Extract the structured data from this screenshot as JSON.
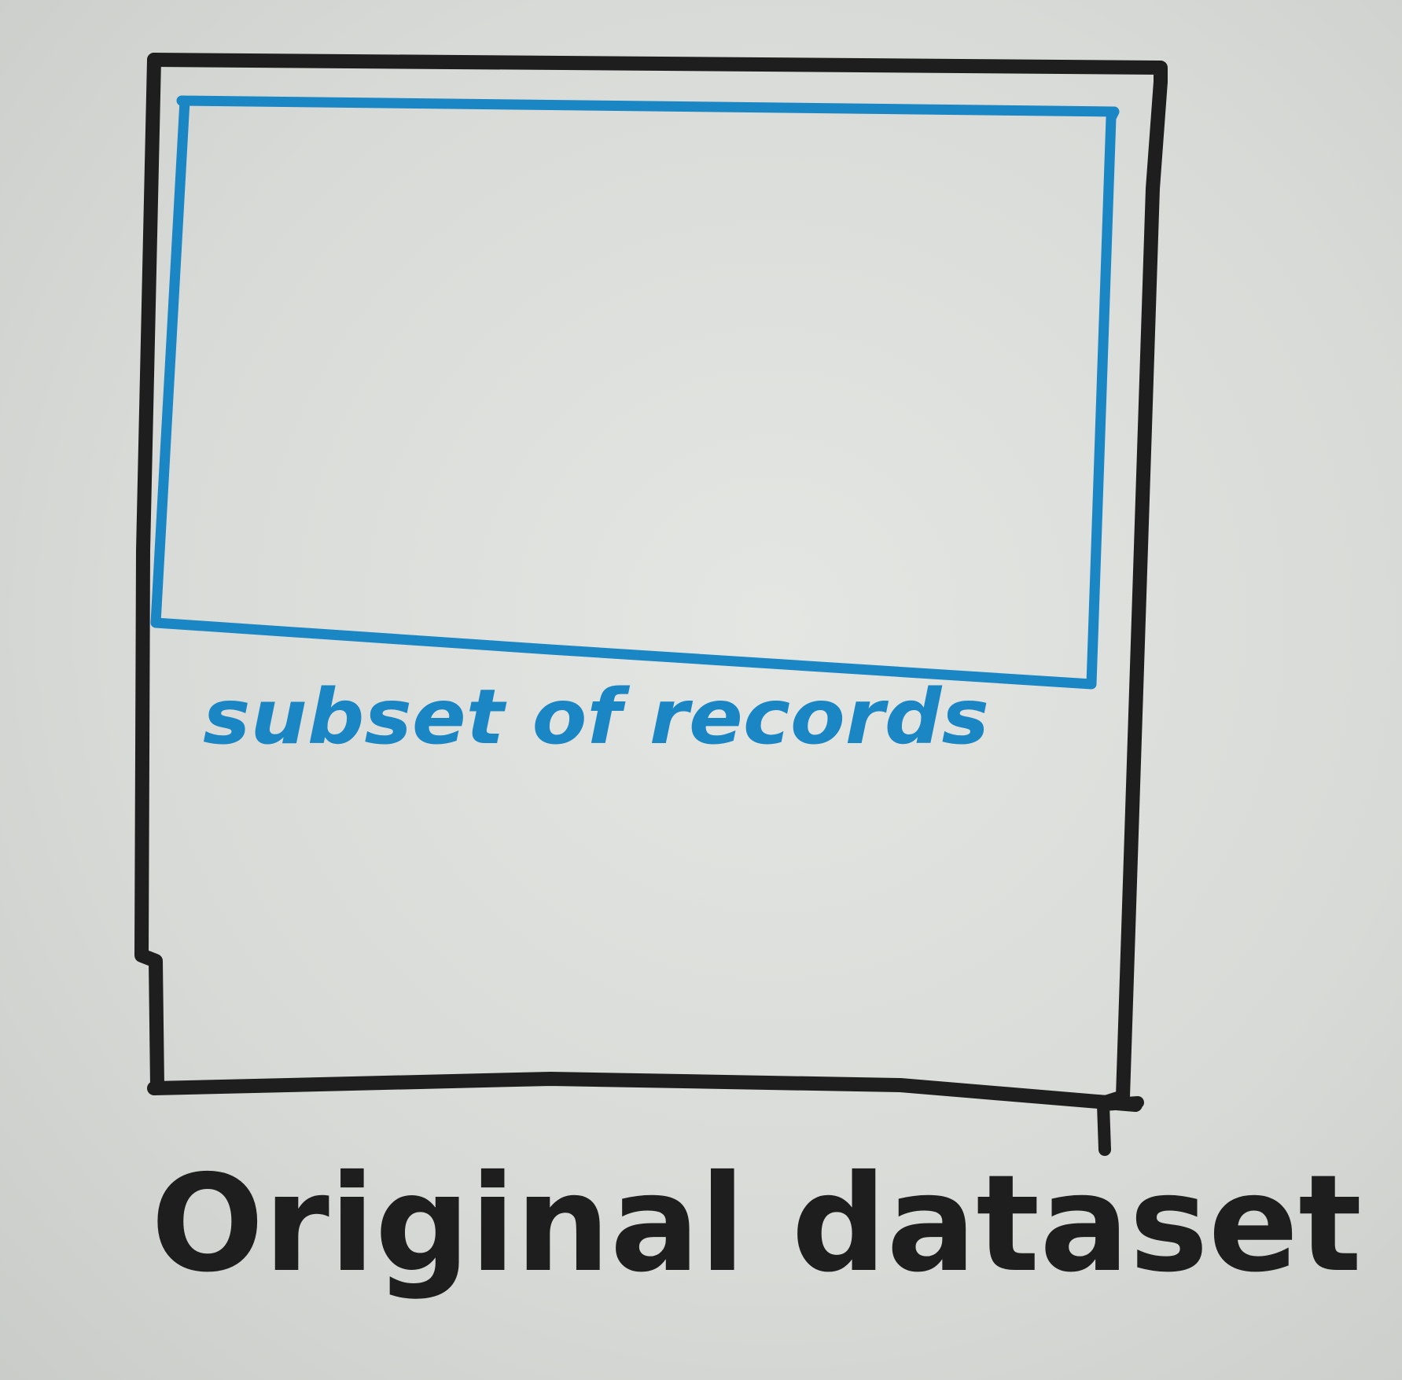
{
  "diagram": {
    "outer_label": "Original dataset",
    "inner_label": "subset of records",
    "colors": {
      "outer_stroke": "#1e1e1e",
      "inner_stroke": "#1a86c4",
      "paper": "#dcdedb"
    }
  }
}
